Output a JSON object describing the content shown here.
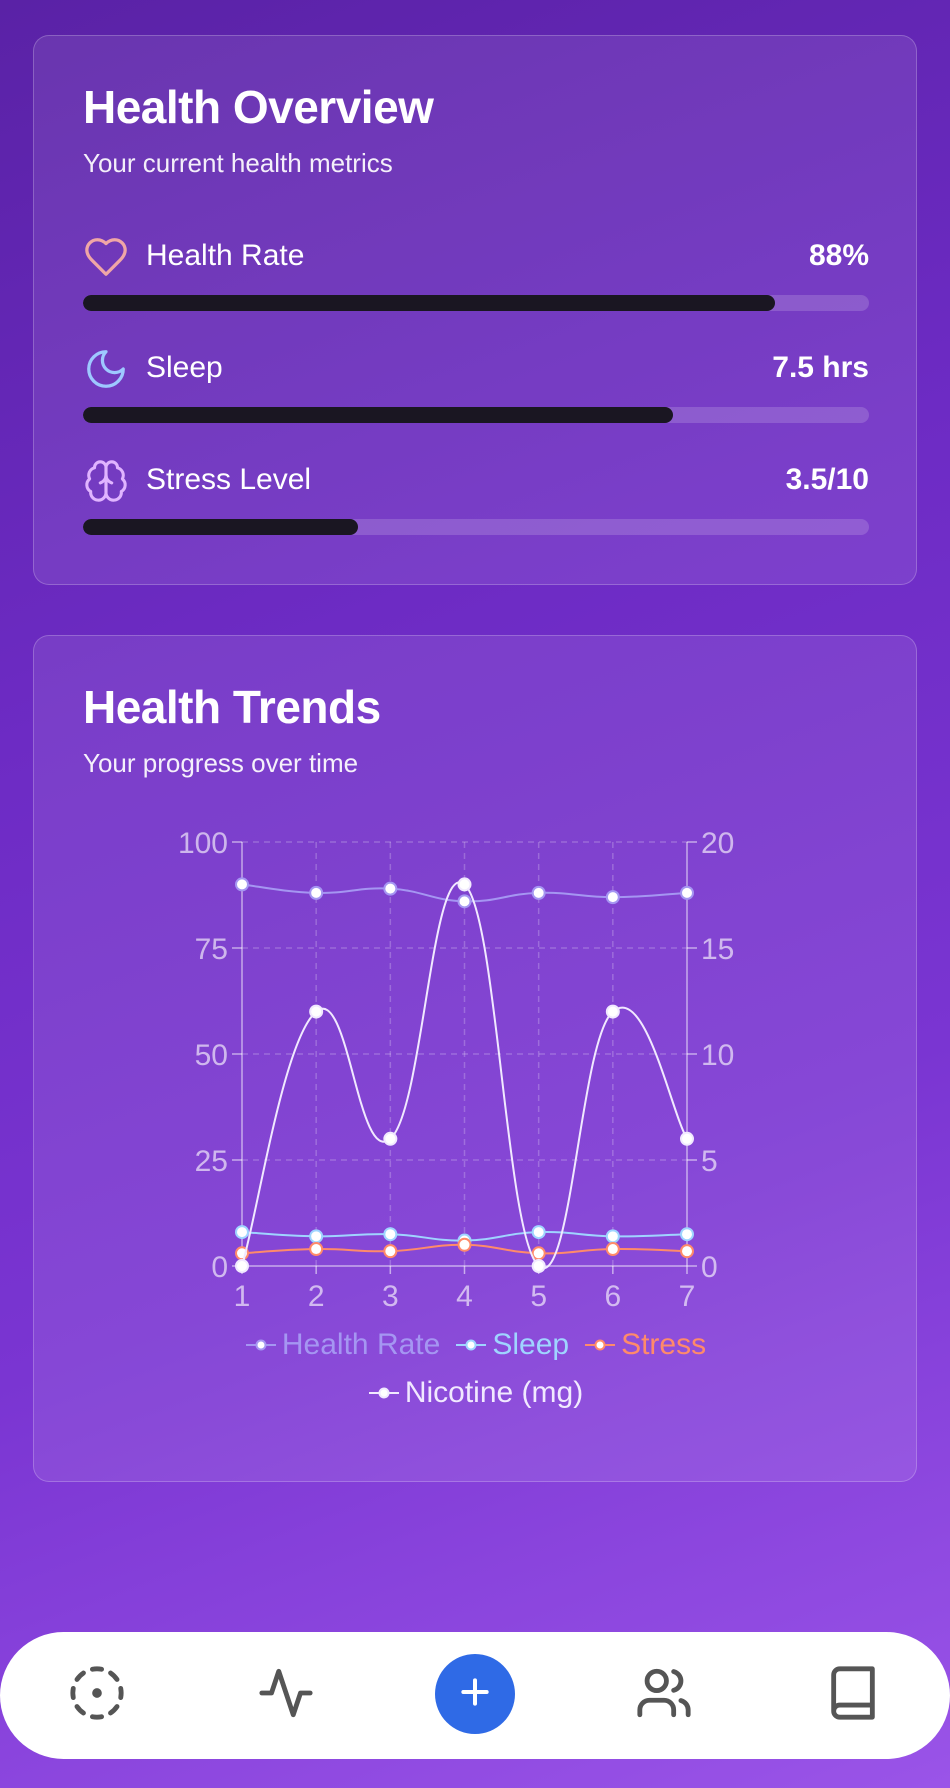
{
  "overview": {
    "title": "Health Overview",
    "subtitle": "Your current health metrics",
    "metrics": [
      {
        "label": "Health Rate",
        "value": "88%",
        "progress": 0.88,
        "icon": "heart-icon",
        "icon_color": "#f0a6a6"
      },
      {
        "label": "Sleep",
        "value": "7.5 hrs",
        "progress": 0.75,
        "icon": "moon-icon",
        "icon_color": "#9ec8ff"
      },
      {
        "label": "Stress Level",
        "value": "3.5/10",
        "progress": 0.35,
        "icon": "brain-icon",
        "icon_color": "#e0b4ff"
      }
    ]
  },
  "trends": {
    "title": "Health Trends",
    "subtitle": "Your progress over time"
  },
  "chart_data": {
    "type": "line",
    "x": [
      1,
      2,
      3,
      4,
      5,
      6,
      7
    ],
    "y_left_ticks": [
      "0",
      "25",
      "50",
      "75",
      "100"
    ],
    "y_right_ticks": [
      "0",
      "5",
      "10",
      "15",
      "20"
    ],
    "ylim_left": [
      0,
      100
    ],
    "ylim_right": [
      0,
      20
    ],
    "grid": true,
    "legend_position": "bottom",
    "series": [
      {
        "name": "Health Rate",
        "axis": "left",
        "color": "#a596f2",
        "values": [
          90,
          88,
          89,
          86,
          88,
          87,
          88
        ]
      },
      {
        "name": "Sleep",
        "axis": "left",
        "color": "#9fd4ff",
        "values": [
          8,
          7,
          7.5,
          6,
          8,
          7,
          7.5
        ]
      },
      {
        "name": "Stress",
        "axis": "left",
        "color": "#ff8a6a",
        "values": [
          3,
          4,
          3.5,
          5,
          3,
          4,
          3.5
        ]
      },
      {
        "name": "Nicotine (mg)",
        "axis": "right",
        "color": "#f1e9ff",
        "values": [
          0,
          12,
          6,
          18,
          0,
          12,
          6
        ]
      }
    ]
  },
  "nav": {
    "items": [
      {
        "icon": "dashed-circle-icon",
        "color": "#555555"
      },
      {
        "icon": "activity-icon",
        "color": "#555555"
      },
      {
        "icon": "plus-icon",
        "color": "#ffffff",
        "accent": "#2f6ae6"
      },
      {
        "icon": "users-icon",
        "color": "#555555"
      },
      {
        "icon": "book-icon",
        "color": "#555555"
      }
    ]
  }
}
